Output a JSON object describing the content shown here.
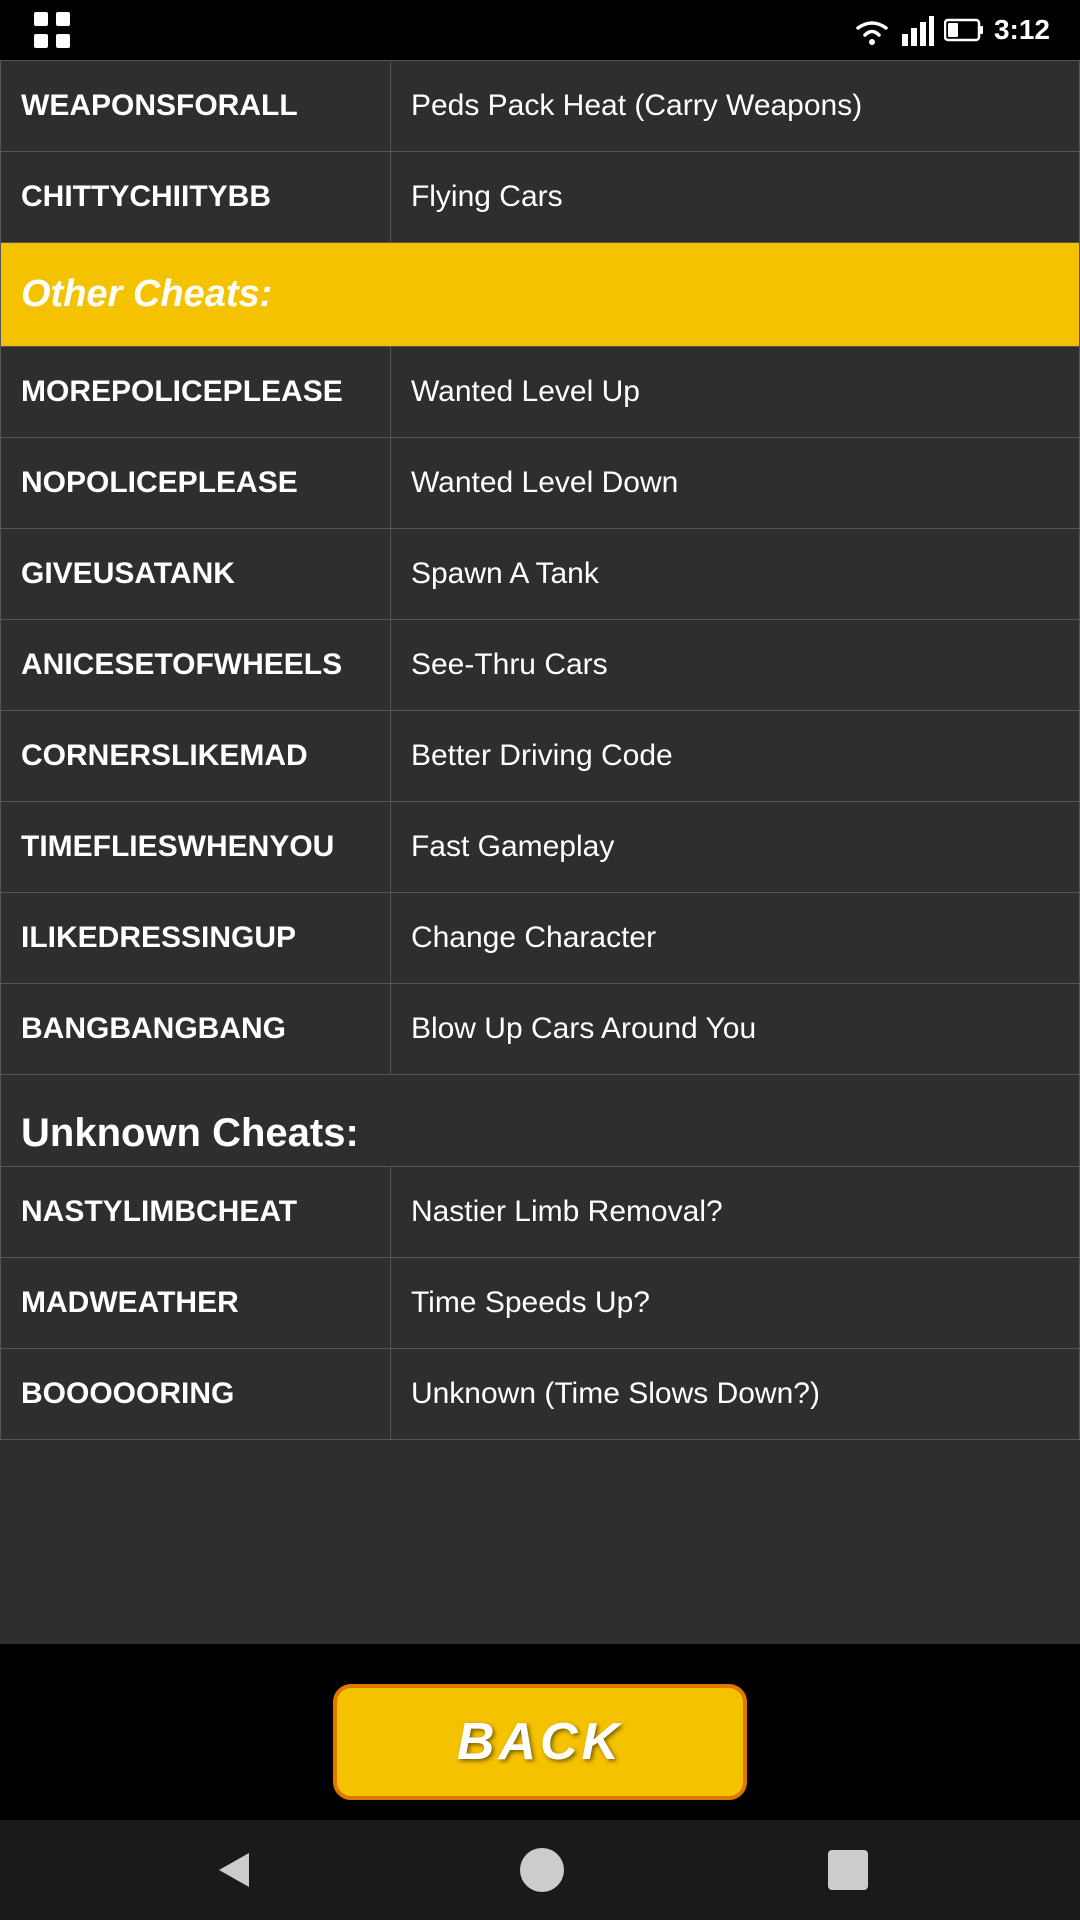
{
  "statusBar": {
    "time": "3:12"
  },
  "table": {
    "topRows": [
      {
        "code": "WEAPONSFORALL",
        "effect": "Peds Pack Heat (Carry Weapons)"
      },
      {
        "code": "CHITTYCHIITYBB",
        "effect": "Flying Cars"
      }
    ],
    "otherCheatsHeader": "Other Cheats:",
    "otherRows": [
      {
        "code": "MOREPOLICEPLEASE",
        "effect": "Wanted Level Up"
      },
      {
        "code": "NOPOLICEPLEASE",
        "effect": "Wanted Level Down"
      },
      {
        "code": "GIVEUSATANK",
        "effect": "Spawn A Tank"
      },
      {
        "code": "ANICESETOFWHEELS",
        "effect": "See-Thru Cars"
      },
      {
        "code": "CORNERSLIKEMAD",
        "effect": "Better Driving Code"
      },
      {
        "code": "TIMEFLIESWHENYOU",
        "effect": "Fast Gameplay"
      },
      {
        "code": "ILIKEDRESSINGUP",
        "effect": "Change Character"
      },
      {
        "code": "BANGBANGBANG",
        "effect": "Blow Up Cars Around You"
      }
    ],
    "unknownCheatsHeader": "Unknown Cheats:",
    "unknownRows": [
      {
        "code": "NASTYLIMBCHEAT",
        "effect": "Nastier Limb Removal?"
      },
      {
        "code": "MADWEATHER",
        "effect": "Time Speeds Up?"
      },
      {
        "code": "BOOOOORING",
        "effect": "Unknown (Time Slows Down?)"
      }
    ]
  },
  "backButton": {
    "label": "BACK"
  }
}
